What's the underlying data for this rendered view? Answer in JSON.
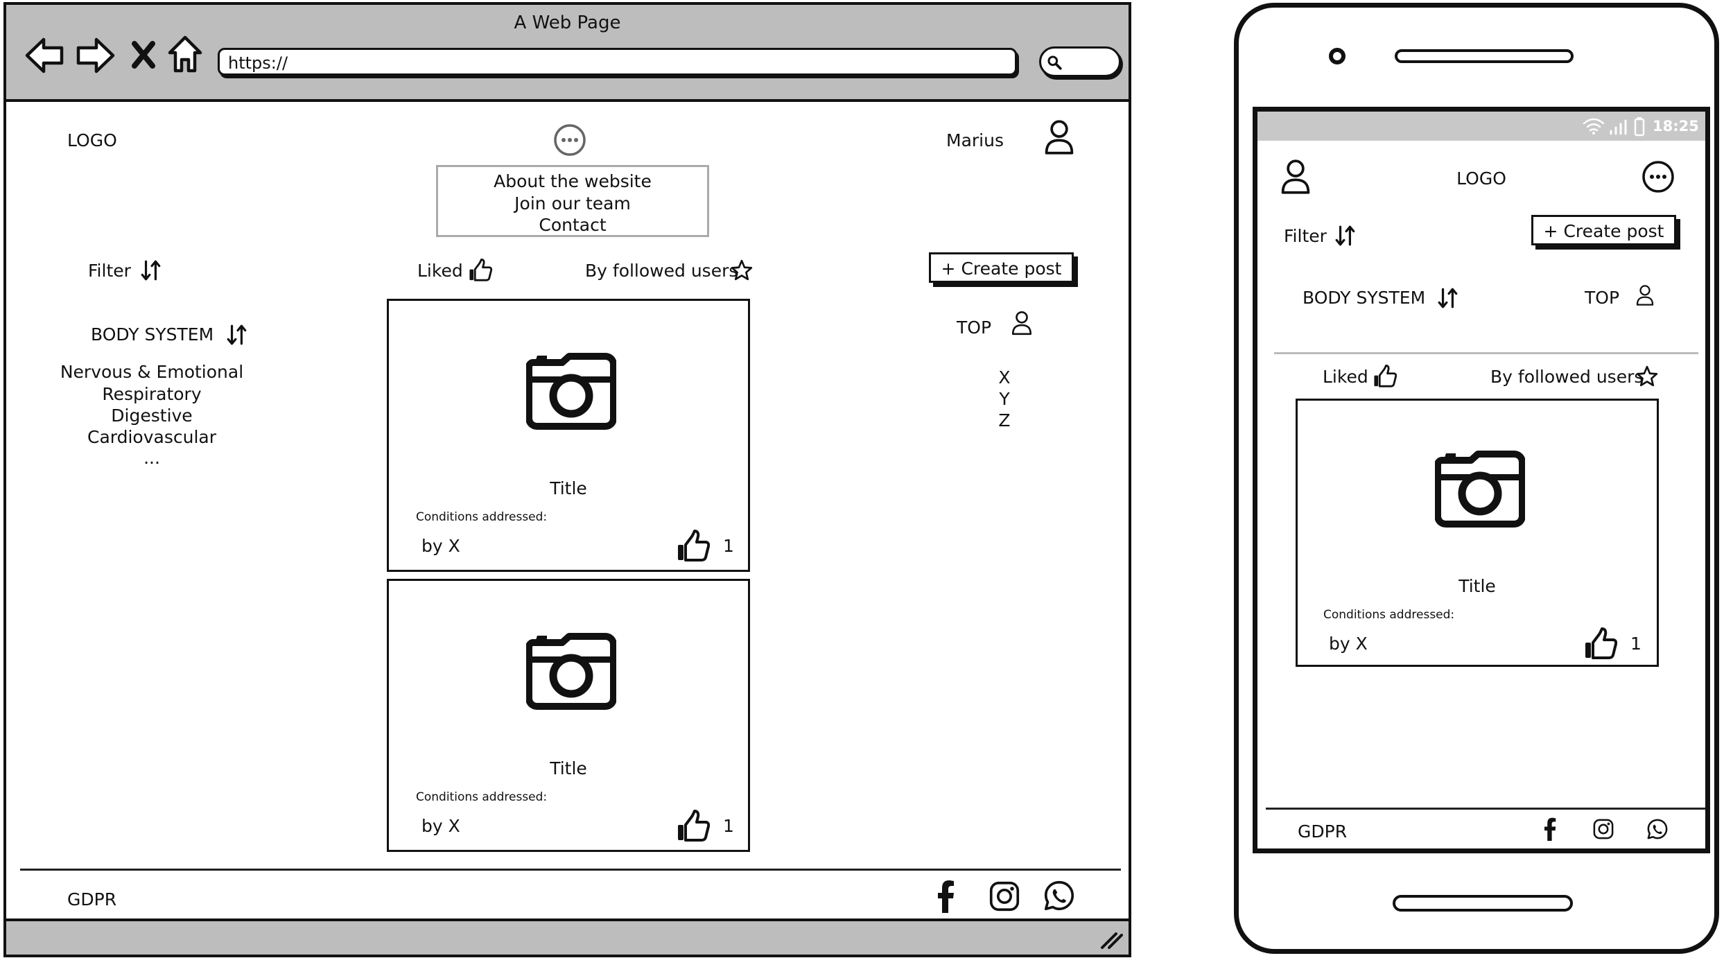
{
  "browser": {
    "title": "A Web Page",
    "url": "https://",
    "header": {
      "logo": "LOGO",
      "username": "Marius"
    },
    "menu": [
      "About the website",
      "Join our team",
      "Contact"
    ],
    "sidebar": {
      "filter_label": "Filter",
      "body_system_label": "BODY SYSTEM",
      "body_systems": [
        "Nervous & Emotional",
        "Respiratory",
        "Digestive",
        "Cardiovascular",
        "..."
      ]
    },
    "feed_tabs": {
      "liked": "Liked",
      "followed": "By followed users"
    },
    "create_post": "+ Create post",
    "top": {
      "label": "TOP",
      "users": [
        "X",
        "Y",
        "Z"
      ]
    },
    "posts": [
      {
        "title": "Title",
        "conditions_label": "Conditions addressed:",
        "author": "by X",
        "likes": "1"
      },
      {
        "title": "Title",
        "conditions_label": "Conditions addressed:",
        "author": "by X",
        "likes": "1"
      }
    ],
    "footer": {
      "gdpr": "GDPR"
    }
  },
  "phone": {
    "status_time": "18:25",
    "logo": "LOGO",
    "filter_label": "Filter",
    "create_post": "+ Create post",
    "body_system_label": "BODY SYSTEM",
    "top_label": "TOP",
    "feed_tabs": {
      "liked": "Liked",
      "followed": "By followed users"
    },
    "post": {
      "title": "Title",
      "conditions_label": "Conditions addressed:",
      "author": "by X",
      "likes": "1"
    },
    "footer": {
      "gdpr": "GDPR"
    }
  },
  "icons": {
    "nav": [
      "back-arrow-icon",
      "forward-arrow-icon",
      "close-icon",
      "home-icon"
    ],
    "social": [
      "facebook-icon",
      "instagram-icon",
      "whatsapp-icon"
    ],
    "other": [
      "search-icon",
      "more-icon",
      "user-icon",
      "sort-icon",
      "thumbs-up-icon",
      "star-icon",
      "camera-icon",
      "wifi-icon",
      "signal-icon",
      "battery-icon",
      "resize-grip-icon"
    ]
  }
}
